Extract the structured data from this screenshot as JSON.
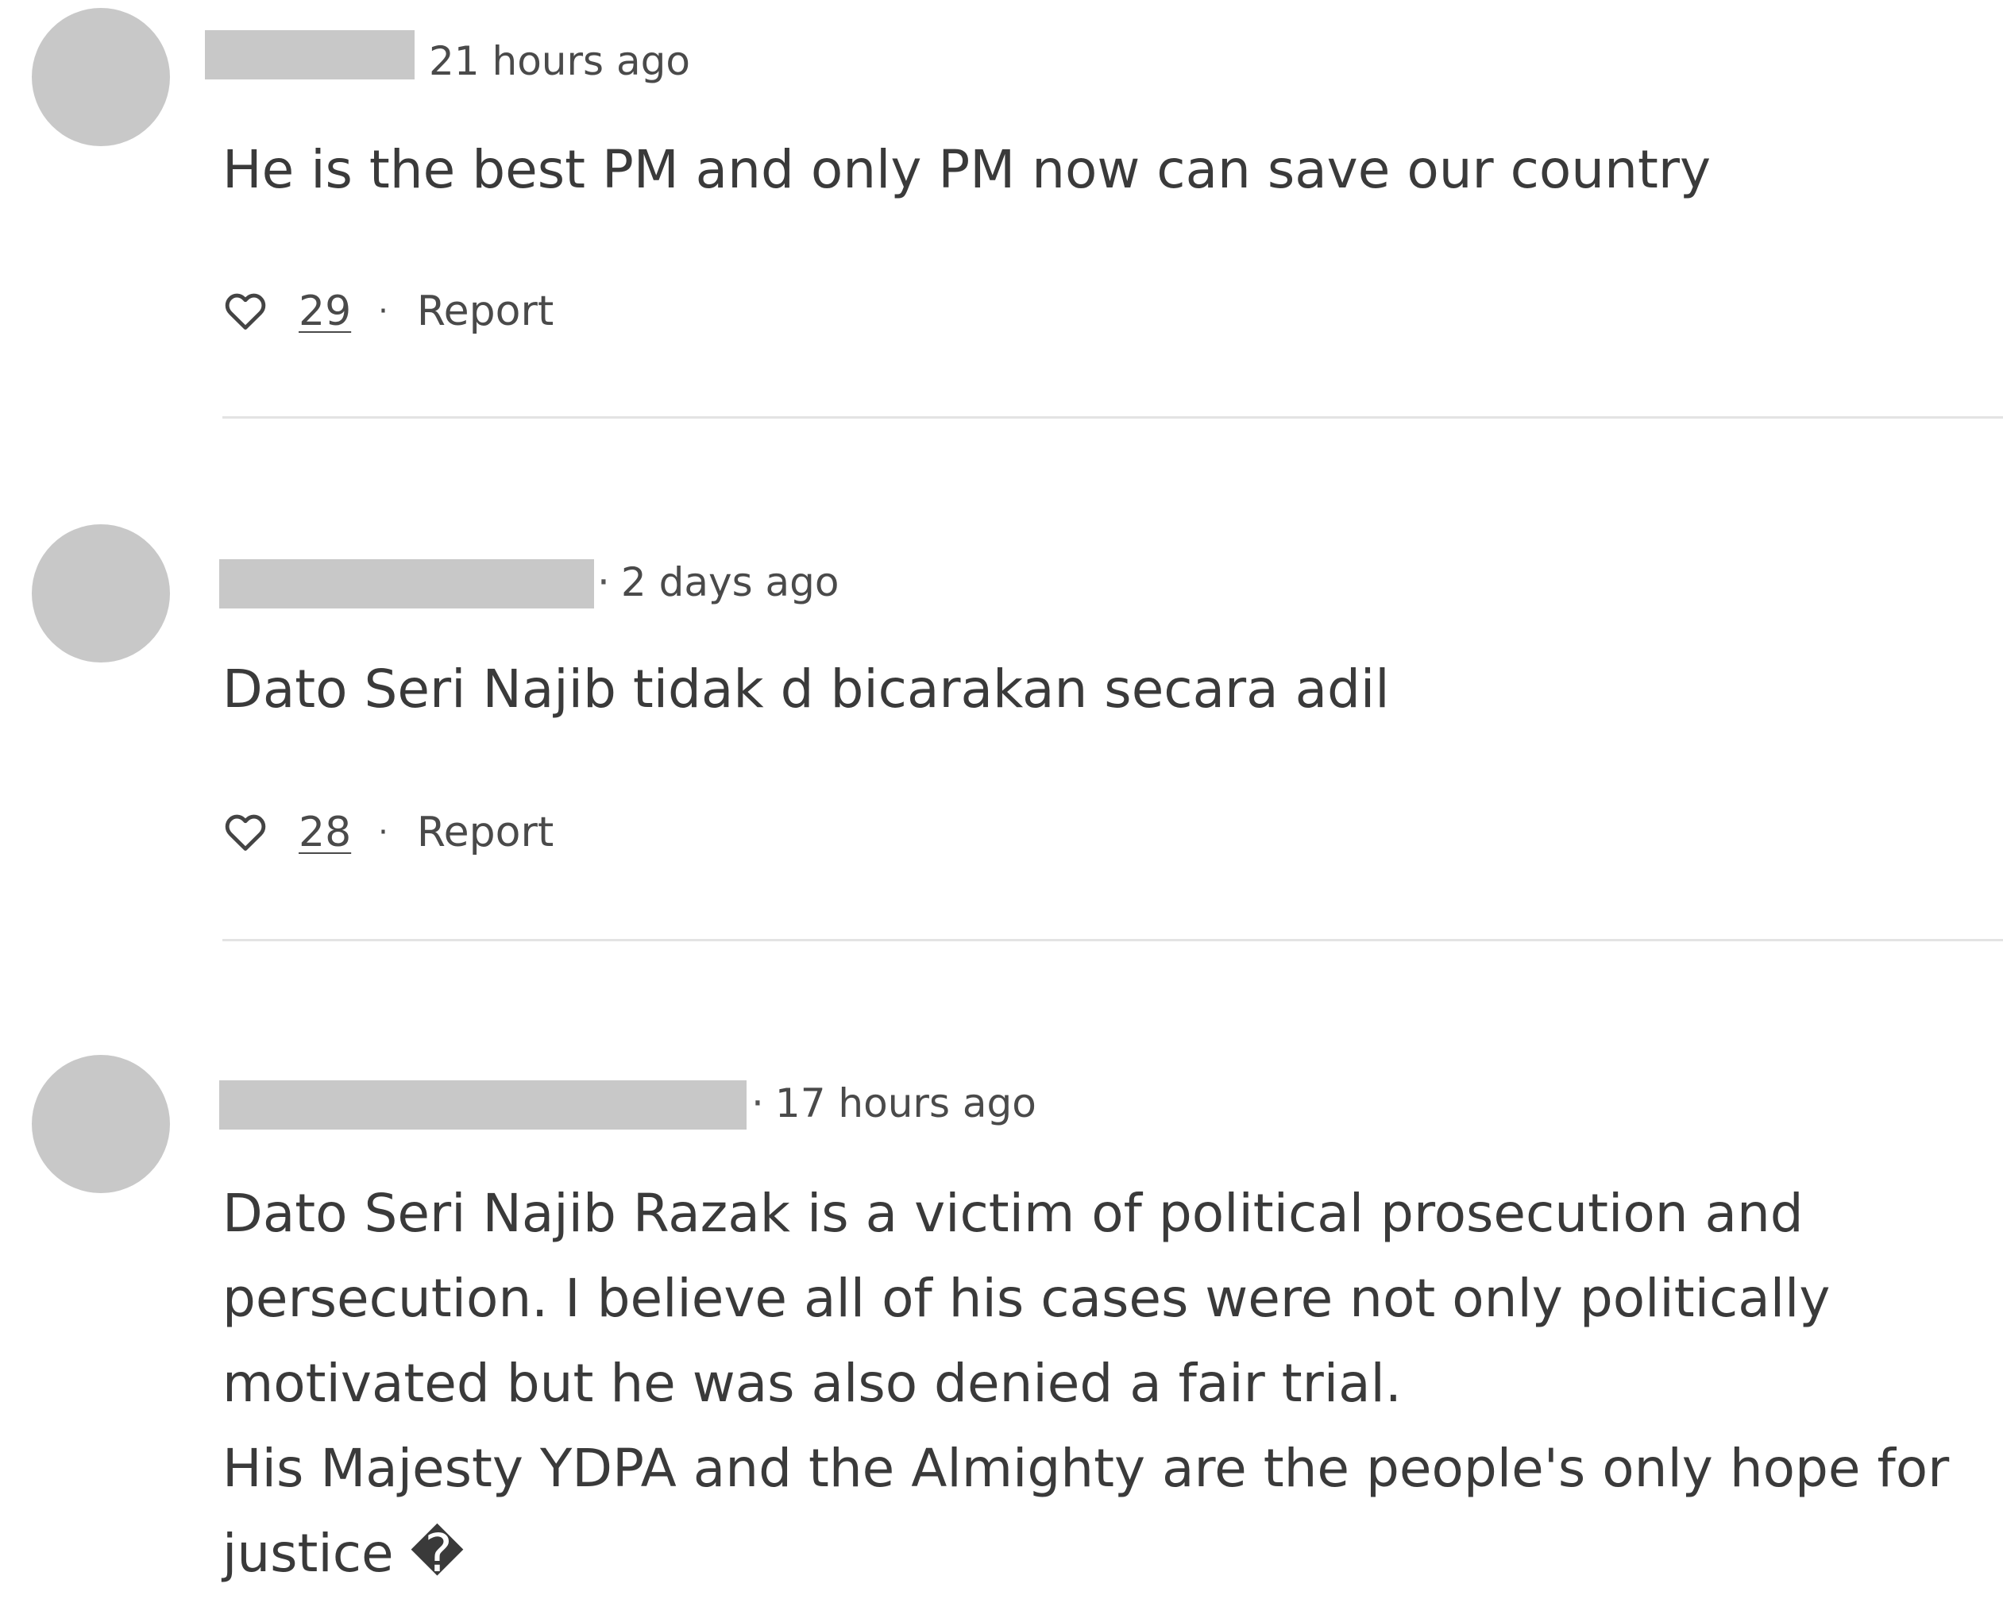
{
  "comments": [
    {
      "separator": "",
      "timestamp": "21 hours ago",
      "text": "He is the best PM and only PM now can save our country",
      "likes": "29",
      "report_label": "Report",
      "action_separator": "·"
    },
    {
      "separator": "·",
      "timestamp": "2 days ago",
      "text": "Dato Seri Najib tidak d bicarakan secara adil",
      "likes": "28",
      "report_label": "Report",
      "action_separator": "·"
    },
    {
      "separator": "·",
      "timestamp": "17 hours ago",
      "text": "Dato Seri Najib Razak is a victim of political prosecution and\npersecution. I believe all of his cases were not only politically\nmotivated but he was also denied a fair trial.\nHis Majesty YDPA and the Almighty are the people's only hope for\njustice �"
    }
  ],
  "colors": {
    "avatar_placeholder": "#c8c8c8",
    "divider": "#e3e3e3",
    "text": "#3a3a3a"
  },
  "icons": {
    "like": "heart-icon"
  }
}
